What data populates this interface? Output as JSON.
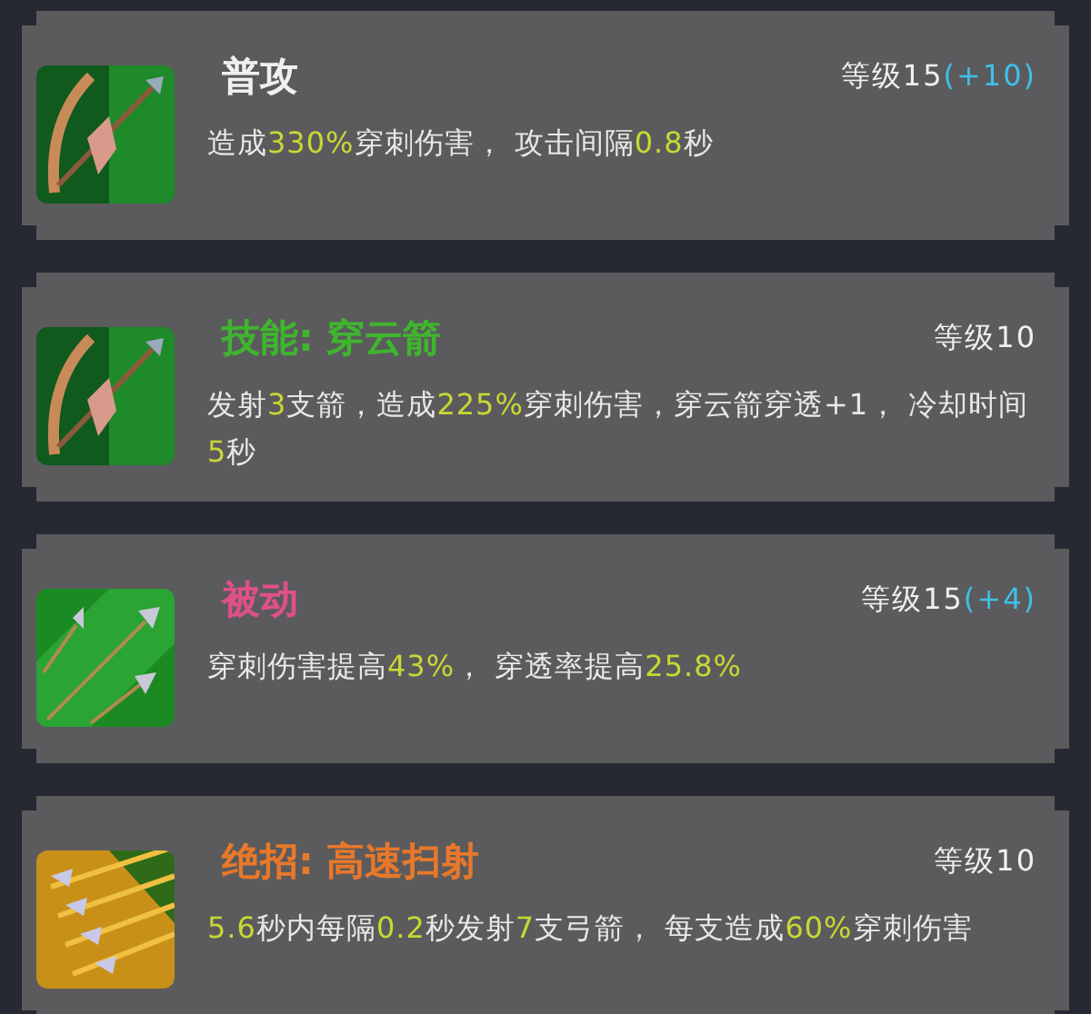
{
  "skills": [
    {
      "kind": "bow",
      "name": "普攻",
      "color": "#f0f0f0",
      "level": "等级15",
      "bonus": "(+10)",
      "description": [
        {
          "text": "造成",
          "highlight": false
        },
        {
          "text": "330%",
          "highlight": true
        },
        {
          "text": "穿刺伤害， 攻击间隔",
          "highlight": false
        },
        {
          "text": "0.8",
          "highlight": true
        },
        {
          "text": "秒",
          "highlight": false
        }
      ]
    },
    {
      "kind": "bow",
      "name": "技能: 穿云箭",
      "color": "#3fb52e",
      "level": "等级10",
      "description": [
        {
          "text": "发射",
          "highlight": false
        },
        {
          "text": "3",
          "highlight": true
        },
        {
          "text": "支箭，造成",
          "highlight": false
        },
        {
          "text": "225%",
          "highlight": true
        },
        {
          "text": "穿刺伤害，穿云箭穿透+1， 冷却时间",
          "highlight": false
        },
        {
          "text": "5",
          "highlight": true
        },
        {
          "text": "秒",
          "highlight": false
        }
      ]
    },
    {
      "kind": "arrows",
      "name": "被动",
      "color": "#e0508a",
      "level": "等级15",
      "bonus": "(+4)",
      "description": [
        {
          "text": "穿刺伤害提高",
          "highlight": false
        },
        {
          "text": "43%",
          "highlight": true
        },
        {
          "text": "， 穿透率提高",
          "highlight": false
        },
        {
          "text": "25.8%",
          "highlight": true
        }
      ]
    },
    {
      "kind": "volley",
      "name": "绝招: 高速扫射",
      "color": "#e8782a",
      "level": "等级10",
      "description": [
        {
          "text": "5.6",
          "highlight": true
        },
        {
          "text": "秒内每隔",
          "highlight": false
        },
        {
          "text": "0.2",
          "highlight": true
        },
        {
          "text": "秒发射",
          "highlight": false
        },
        {
          "text": "7",
          "highlight": true
        },
        {
          "text": "支弓箭， 每支造成",
          "highlight": false
        },
        {
          "text": "60%",
          "highlight": true
        },
        {
          "text": "穿刺伤害",
          "highlight": false
        }
      ]
    }
  ]
}
